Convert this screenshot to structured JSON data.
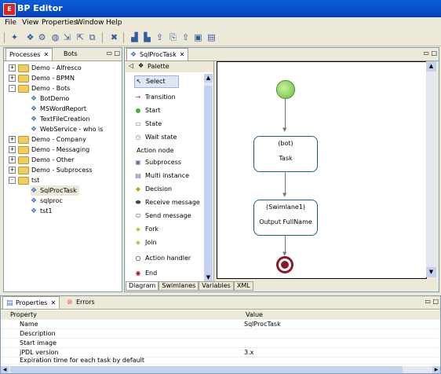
{
  "window": {
    "title": "BP Editor",
    "icon": "app-icon"
  },
  "menu": [
    "File",
    "View",
    "Properties",
    "Window",
    "Help"
  ],
  "processes_panel": {
    "tabs": [
      {
        "label": "Processes"
      },
      {
        "label": "Bots"
      }
    ],
    "tree": [
      {
        "label": "Demo - Alfresco",
        "expander": "+"
      },
      {
        "label": "Demo - BPMN",
        "expander": "+"
      },
      {
        "label": "Demo - Bots",
        "expander": "-"
      },
      {
        "label": "BotDemo"
      },
      {
        "label": "MSWordReport"
      },
      {
        "label": "TextFileCreation"
      },
      {
        "label": "WebService - who is"
      },
      {
        "label": "Demo - Company",
        "expander": "+"
      },
      {
        "label": "Demo - Messaging",
        "expander": "+"
      },
      {
        "label": "Demo - Other",
        "expander": "+"
      },
      {
        "label": "Demo - Subprocess",
        "expander": "+"
      },
      {
        "label": "tst",
        "expander": "-"
      },
      {
        "label": "SqlProcTask"
      },
      {
        "label": "sqlproc"
      },
      {
        "label": "tst1"
      }
    ]
  },
  "editor": {
    "tab_label": "SqlProcTask",
    "palette_title": "Palette",
    "palette_items": [
      {
        "label": "Select",
        "icon": "cursor-icon"
      },
      {
        "label": "Transition",
        "icon": "transition-icon"
      },
      {
        "label": "Start",
        "icon": "start-icon"
      },
      {
        "label": "State",
        "icon": "state-icon"
      },
      {
        "label": "Wait state",
        "icon": "wait-icon"
      },
      {
        "label": "Action node",
        "icon": ""
      },
      {
        "label": "Subprocess",
        "icon": "subprocess-icon"
      },
      {
        "label": "Multi instance",
        "icon": "multi-instance-icon"
      },
      {
        "label": "Decision",
        "icon": "decision-icon"
      },
      {
        "label": "Receive message",
        "icon": "receive-icon"
      },
      {
        "label": "Send message",
        "icon": "send-icon"
      },
      {
        "label": "Fork",
        "icon": "fork-icon"
      },
      {
        "label": "Join",
        "icon": "join-icon"
      },
      {
        "label": "Action handler",
        "icon": "action-icon"
      },
      {
        "label": "End",
        "icon": "end-icon"
      }
    ],
    "diagram": {
      "node1": {
        "line1": "(bot)",
        "line2": "Task"
      },
      "node2": {
        "line1": "(Swimlane1)",
        "line2": "Output FullName"
      }
    },
    "bottom_tabs": [
      "Diagram",
      "Swimlanes",
      "Variables",
      "XML"
    ]
  },
  "properties_panel": {
    "tabs": [
      {
        "label": "Properties"
      },
      {
        "label": "Errors"
      }
    ],
    "columns": [
      "Property",
      "Value"
    ],
    "rows": [
      {
        "name": "Name",
        "value": "SqlProcTask"
      },
      {
        "name": "Description",
        "value": ""
      },
      {
        "name": "Start image",
        "value": ""
      },
      {
        "name": "jPDL version",
        "value": "3.x"
      },
      {
        "name": "Expiration time for each task by default",
        "value": ""
      }
    ]
  }
}
